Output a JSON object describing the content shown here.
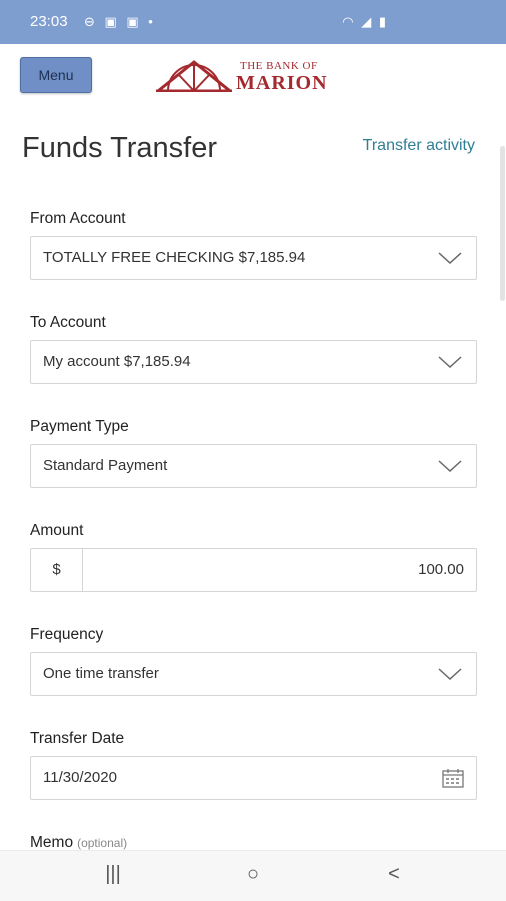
{
  "status": {
    "time": "23:03",
    "left_icons": "⊖ ▣ ▣ •",
    "right_icons": "◠ ◢ ▮"
  },
  "header": {
    "menu_label": "Menu",
    "logo_line1": "THE BANK OF",
    "logo_line2": "MARION",
    "brand_color": "#a42a2f"
  },
  "page": {
    "title": "Funds Transfer",
    "activity_link": "Transfer activity"
  },
  "form": {
    "from": {
      "label": "From Account",
      "value": "TOTALLY FREE CHECKING  $7,185.94"
    },
    "to": {
      "label": "To Account",
      "value": "My account  $7,185.94"
    },
    "payment_type": {
      "label": "Payment Type",
      "value": "Standard Payment"
    },
    "amount": {
      "label": "Amount",
      "currency": "$",
      "value": "100.00"
    },
    "frequency": {
      "label": "Frequency",
      "value": "One time transfer"
    },
    "date": {
      "label": "Transfer Date",
      "value": "11/30/2020"
    },
    "memo": {
      "label": "Memo",
      "optional": "(optional)"
    }
  },
  "nav": {
    "recent": "|||",
    "home": "○",
    "back": "<"
  },
  "icons": [
    "chevron-down-icon",
    "calendar-icon",
    "recent-apps-icon",
    "home-icon",
    "back-icon"
  ]
}
